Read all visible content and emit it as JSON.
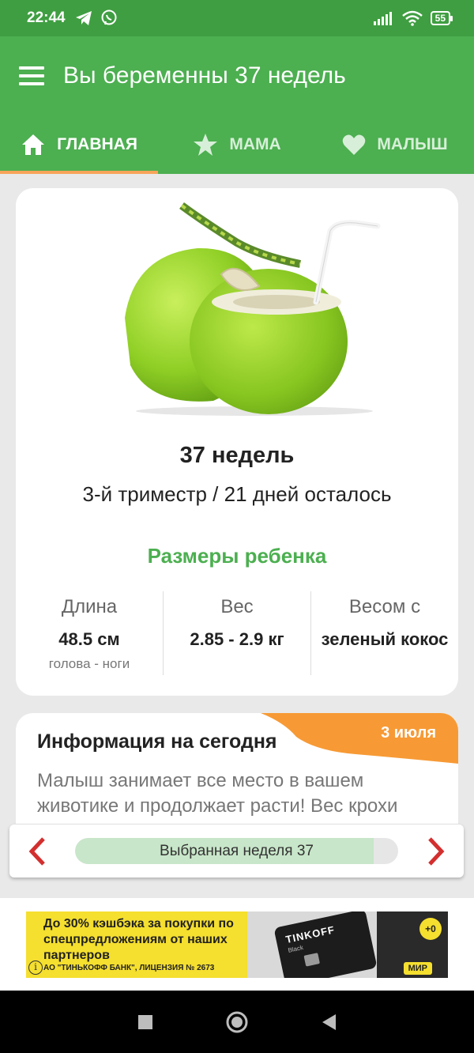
{
  "status_bar": {
    "time": "22:44",
    "battery": "55"
  },
  "app_bar": {
    "title": "Вы беременны 37 недель"
  },
  "tabs": [
    {
      "label": "ГЛАВНАЯ",
      "icon": "home-icon",
      "active": true
    },
    {
      "label": "МАМА",
      "icon": "star-icon",
      "active": false
    },
    {
      "label": "МАЛЫШ",
      "icon": "heart-icon",
      "active": false
    }
  ],
  "summary": {
    "fruit_image": "green-coconut",
    "week_title": "37 недель",
    "subtitle": "3-й триместр / 21 дней осталось",
    "sizes_title": "Размеры ребенка",
    "metrics": [
      {
        "label": "Длина",
        "value": "48.5 см",
        "note": "голова - ноги"
      },
      {
        "label": "Вес",
        "value": "2.85 - 2.9 кг",
        "note": ""
      },
      {
        "label": "Весом с",
        "value": "зеленый кокос",
        "note": ""
      }
    ]
  },
  "info": {
    "title": "Информация на сегодня",
    "date": "3 июля",
    "text": "Малыш занимает все место в вашем животике и продолжает расти! Вес крохи"
  },
  "week_selector": {
    "label": "Выбранная неделя 37",
    "week": 37,
    "progress": 0.925
  },
  "ad": {
    "text": "До 30% кэшбэка за покупки по спецпредложениям от наших партнеров",
    "legal": "АО \"ТИНЬКОФФ БАНК\", ЛИЦЕНЗИЯ № 2673",
    "card_brand": "TINKOFF",
    "card_sub": "Black",
    "badge": "+0",
    "mir": "МИР"
  },
  "colors": {
    "primary": "#4caf50",
    "status": "#3f9e41",
    "accent": "#f7a45a",
    "arrow": "#d32f2f"
  }
}
